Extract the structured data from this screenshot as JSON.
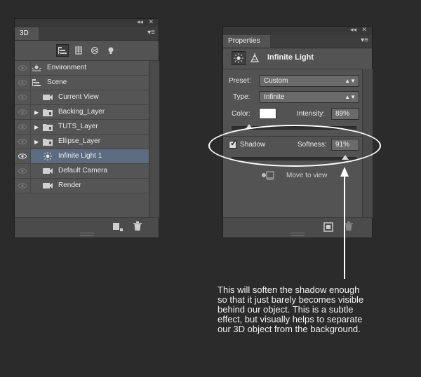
{
  "panel_3d": {
    "tab": "3D",
    "collapse_glyph": "◂◂",
    "close_glyph": "✕",
    "menu_glyph": "▾≡",
    "filters": [
      "scene-filter-icon",
      "mesh-filter-icon",
      "material-filter-icon",
      "light-filter-icon"
    ],
    "layers": [
      {
        "label": "Environment",
        "icon": "environment-icon"
      },
      {
        "label": "Scene",
        "icon": "scene-icon"
      },
      {
        "label": "Current View",
        "icon": "camera-icon"
      },
      {
        "label": "Backing_Layer",
        "icon": "mesh-folder-icon"
      },
      {
        "label": "TUTS_Layer",
        "icon": "mesh-folder-icon"
      },
      {
        "label": "Ellipse_Layer",
        "icon": "mesh-folder-icon"
      },
      {
        "label": "Infinite Light 1",
        "icon": "infinite-light-icon"
      },
      {
        "label": "Default Camera",
        "icon": "camera-icon"
      },
      {
        "label": "Render",
        "icon": "camera-icon"
      }
    ],
    "selected_index": 6
  },
  "panel_props": {
    "tab": "Properties",
    "collapse_glyph": "◂◂",
    "close_glyph": "✕",
    "menu_glyph": "▾≡",
    "title": "Infinite Light",
    "preset_label": "Preset:",
    "preset_value": "Custom",
    "type_label": "Type:",
    "type_value": "Infinite",
    "color_label": "Color:",
    "color_value": "#ffffff",
    "intensity_label": "Intensity:",
    "intensity_value": "89%",
    "intensity_fraction": 0.89,
    "shadow_label": "Shadow",
    "shadow_checked": true,
    "softness_label": "Softness:",
    "softness_value": "91%",
    "softness_fraction": 0.91,
    "move_to_view": "Move to view"
  },
  "annotation": {
    "text": "This will soften the shadow enough\nso that it just barely becomes visible\nbehind our object. This is a subtle\neffect, but visually helps to separate\nour 3D object from the background."
  }
}
